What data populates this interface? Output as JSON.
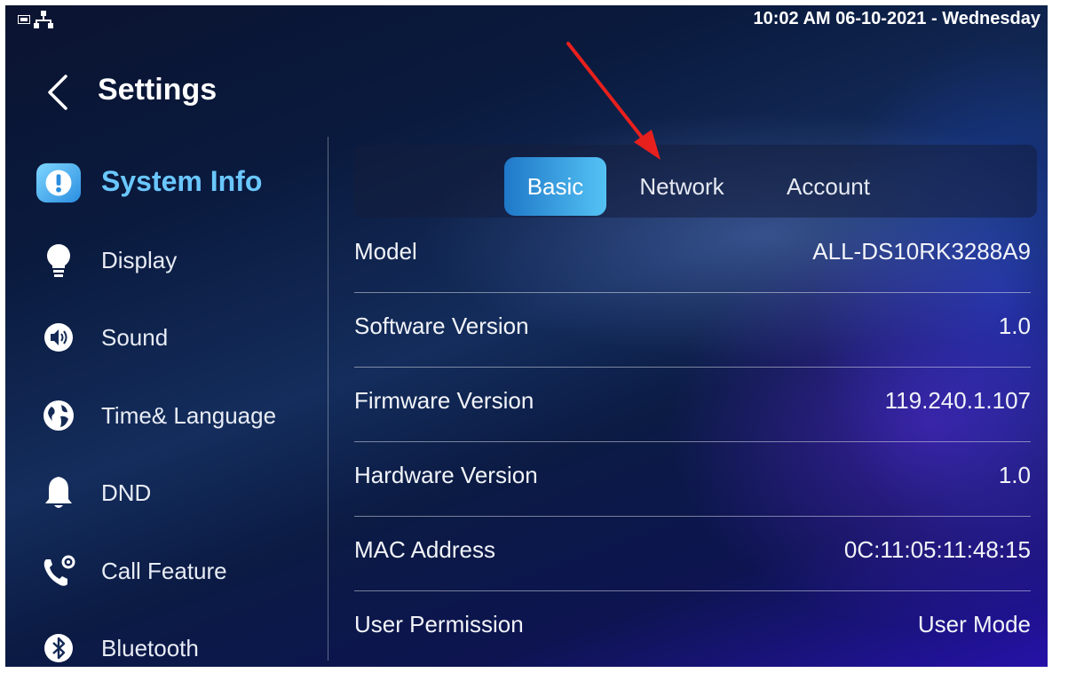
{
  "status_bar": {
    "datetime": "10:02 AM  06-10-2021 - Wednesday",
    "icons": [
      "screen-icon",
      "network-icon"
    ]
  },
  "header": {
    "title": "Settings",
    "back_icon": "chevron-left-icon"
  },
  "sidebar": {
    "items": [
      {
        "label": "System Info",
        "icon": "info-icon",
        "active": true
      },
      {
        "label": "Display",
        "icon": "bulb-icon"
      },
      {
        "label": "Sound",
        "icon": "speaker-icon"
      },
      {
        "label": "Time& Language",
        "icon": "globe-icon"
      },
      {
        "label": "DND",
        "icon": "bell-icon"
      },
      {
        "label": "Call Feature",
        "icon": "phone-settings-icon"
      },
      {
        "label": "Bluetooth",
        "icon": "bluetooth-icon"
      }
    ]
  },
  "tabs": [
    {
      "label": "Basic",
      "active": true
    },
    {
      "label": "Network"
    },
    {
      "label": "Account"
    }
  ],
  "info_rows": [
    {
      "key": "Model",
      "value": "ALL-DS10RK3288A9"
    },
    {
      "key": "Software Version",
      "value": "1.0"
    },
    {
      "key": "Firmware Version",
      "value": "119.240.1.107"
    },
    {
      "key": "Hardware Version",
      "value": "1.0"
    },
    {
      "key": "MAC Address",
      "value": "0C:11:05:11:48:15"
    },
    {
      "key": "User Permission",
      "value": "User Mode"
    }
  ],
  "colors": {
    "accent_text": "#6ac7ff",
    "tab_active_start": "#1f78c8",
    "tab_active_end": "#54c2f4",
    "annotation_arrow": "#e8201d"
  }
}
